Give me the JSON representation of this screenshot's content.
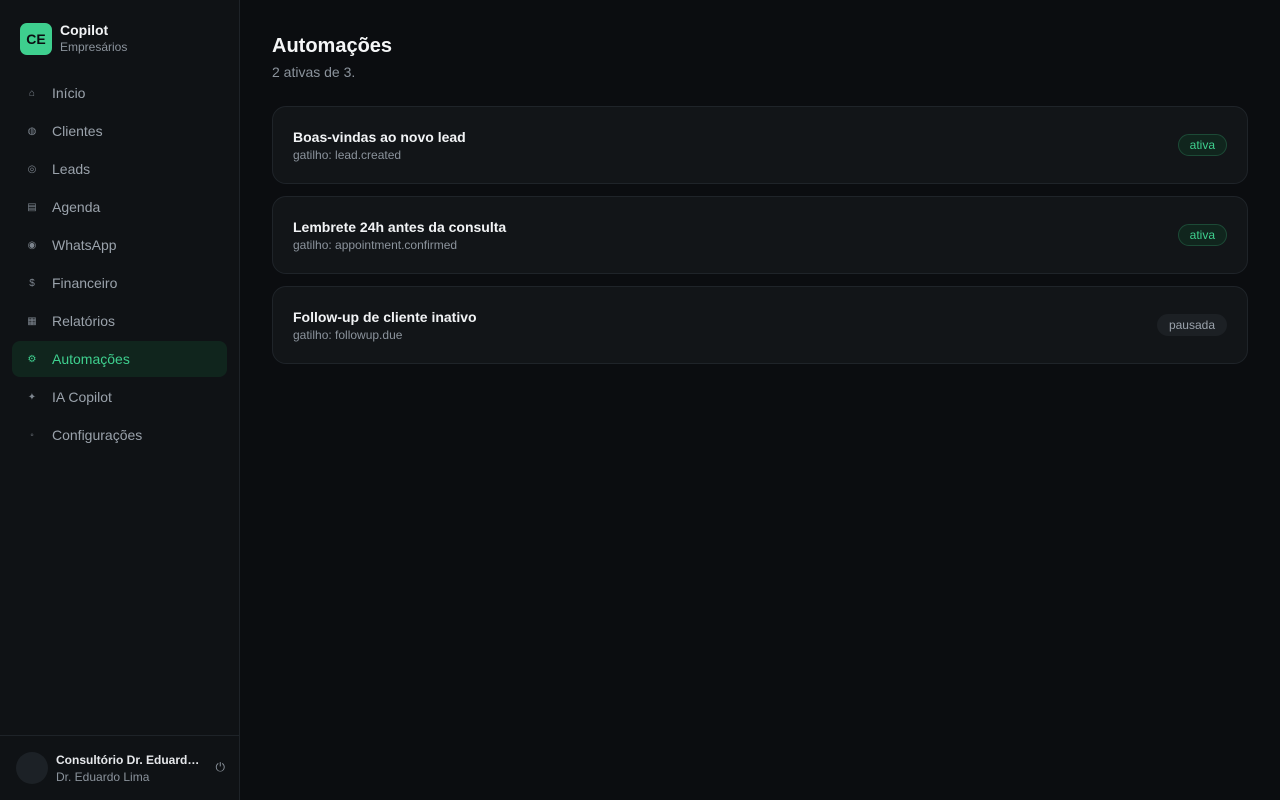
{
  "brand": {
    "logo_text": "CE",
    "name": "Copilot",
    "subtitle": "Empresários"
  },
  "nav": [
    {
      "icon": "⌂",
      "icon_name": "home-icon",
      "label": "Início",
      "active": false
    },
    {
      "icon": "◍",
      "icon_name": "clients-icon",
      "label": "Clientes",
      "active": false
    },
    {
      "icon": "◎",
      "icon_name": "target-icon",
      "label": "Leads",
      "active": false
    },
    {
      "icon": "▤",
      "icon_name": "calendar-icon",
      "label": "Agenda",
      "active": false
    },
    {
      "icon": "◉",
      "icon_name": "whatsapp-icon",
      "label": "WhatsApp",
      "active": false
    },
    {
      "icon": "$",
      "icon_name": "dollar-icon",
      "label": "Financeiro",
      "active": false
    },
    {
      "icon": "▦",
      "icon_name": "chart-icon",
      "label": "Relatórios",
      "active": false
    },
    {
      "icon": "⚙",
      "icon_name": "gear-icon",
      "label": "Automações",
      "active": true
    },
    {
      "icon": "✦",
      "icon_name": "sparkle-icon",
      "label": "IA Copilot",
      "active": false
    },
    {
      "icon": "◦",
      "icon_name": "settings-icon",
      "label": "Configurações",
      "active": false
    }
  ],
  "user": {
    "org": "Consultório Dr. Eduardo Lima",
    "name": "Dr. Eduardo Lima",
    "logout_icon": "⏻"
  },
  "page": {
    "title": "Automações",
    "subtitle": "2 ativas de 3."
  },
  "automations": [
    {
      "title": "Boas-vindas ao novo lead",
      "trigger": "gatilho: lead.created",
      "status": "ativa"
    },
    {
      "title": "Lembrete 24h antes da consulta",
      "trigger": "gatilho: appointment.confirmed",
      "status": "ativa"
    },
    {
      "title": "Follow-up de cliente inativo",
      "trigger": "gatilho: followup.due",
      "status": "pausada"
    }
  ],
  "colors": {
    "accent": "#3ecf8e",
    "background": "#0b0d10",
    "sidebar": "#0f1215",
    "card": "#121518"
  }
}
